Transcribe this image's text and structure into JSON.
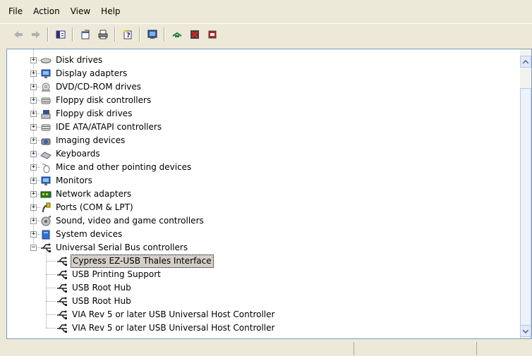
{
  "menu": [
    "File",
    "Action",
    "View",
    "Help"
  ],
  "toolbar": {
    "buttons": [
      {
        "name": "back-arrow-icon"
      },
      {
        "name": "forward-arrow-icon"
      },
      {
        "name": "show-hide-console-tree-icon"
      },
      {
        "name": "properties-icon"
      },
      {
        "name": "print-icon"
      },
      {
        "name": "help-icon"
      },
      {
        "name": "scan-hardware-changes-icon"
      },
      {
        "name": "update-driver-icon"
      },
      {
        "name": "disable-device-icon"
      },
      {
        "name": "uninstall-device-icon"
      }
    ]
  },
  "tree": {
    "categories": [
      {
        "label": "Disk drives",
        "icon": "disk-drive-icon",
        "expanded": false
      },
      {
        "label": "Display adapters",
        "icon": "display-adapter-icon",
        "expanded": false
      },
      {
        "label": "DVD/CD-ROM drives",
        "icon": "dvd-drive-icon",
        "expanded": false
      },
      {
        "label": "Floppy disk controllers",
        "icon": "floppy-controller-icon",
        "expanded": false
      },
      {
        "label": "Floppy disk drives",
        "icon": "floppy-drive-icon",
        "expanded": false
      },
      {
        "label": "IDE ATA/ATAPI controllers",
        "icon": "ide-controller-icon",
        "expanded": false
      },
      {
        "label": "Imaging devices",
        "icon": "camera-icon",
        "expanded": false
      },
      {
        "label": "Keyboards",
        "icon": "keyboard-icon",
        "expanded": false
      },
      {
        "label": "Mice and other pointing devices",
        "icon": "mouse-icon",
        "expanded": false
      },
      {
        "label": "Monitors",
        "icon": "monitor-icon",
        "expanded": false
      },
      {
        "label": "Network adapters",
        "icon": "network-adapter-icon",
        "expanded": false
      },
      {
        "label": "Ports (COM & LPT)",
        "icon": "port-icon",
        "expanded": false
      },
      {
        "label": "Sound, video and game controllers",
        "icon": "sound-icon",
        "expanded": false
      },
      {
        "label": "System devices",
        "icon": "system-device-icon",
        "expanded": false
      },
      {
        "label": "Universal Serial Bus controllers",
        "icon": "usb-icon",
        "expanded": true
      }
    ],
    "usb_children": [
      {
        "label": "Cypress EZ-USB Thales Interface",
        "selected": true
      },
      {
        "label": "USB Printing Support",
        "selected": false
      },
      {
        "label": "USB Root Hub",
        "selected": false
      },
      {
        "label": "USB Root Hub",
        "selected": false
      },
      {
        "label": "VIA Rev 5 or later USB Universal Host Controller",
        "selected": false
      },
      {
        "label": "VIA Rev 5 or later USB Universal Host Controller",
        "selected": false
      }
    ]
  },
  "colors": {
    "window_bg": "#ece9d8",
    "pane_border": "#7f9db9",
    "selection_bg": "#d4d0c8"
  }
}
